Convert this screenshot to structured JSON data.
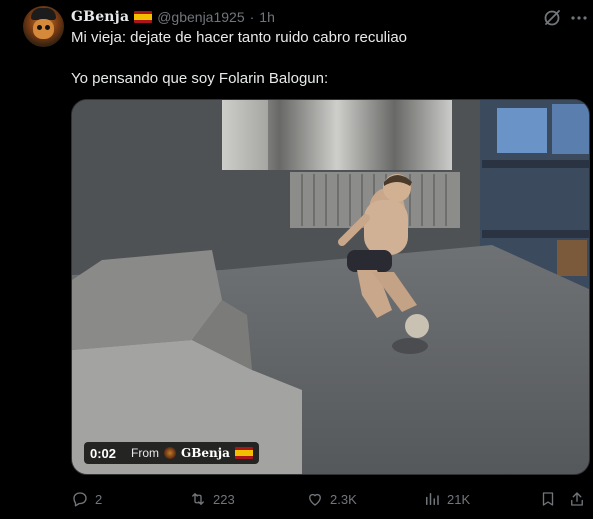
{
  "author": {
    "display_name": "GBenja",
    "handle": "@gbenja1925",
    "separator": "·",
    "timestamp": "1h",
    "flag_icon": "spain-flag-icon"
  },
  "tweet": {
    "line1": "Mi vieja: dejate de hacer tanto ruido cabro reculiao",
    "line2": "Yo pensando que soy Folarin Balogun:"
  },
  "video": {
    "elapsed": "0:02",
    "from_label": "From",
    "source_name": "GBenja"
  },
  "actions": {
    "replies": "2",
    "reposts": "223",
    "likes": "2.3K",
    "views": "21K"
  },
  "icons": {
    "grok": "grok-icon",
    "more": "more-icon",
    "reply": "reply-icon",
    "repost": "repost-icon",
    "like": "heart-icon",
    "views": "views-icon",
    "bookmark": "bookmark-icon",
    "share": "share-icon"
  },
  "colors": {
    "background": "#000000",
    "text": "#e7e9ea",
    "muted": "#71767b",
    "border": "#2f3336"
  }
}
